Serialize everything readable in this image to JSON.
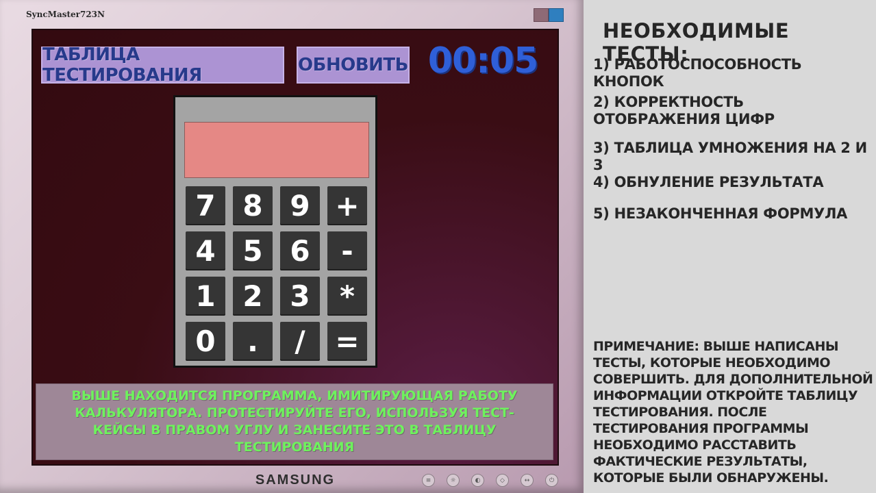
{
  "monitor": {
    "model": "SyncMaster723N",
    "brand": "SAMSUNG"
  },
  "toolbar": {
    "table_button_label": "ТАБЛИЦА ТЕСТИРОВАНИЯ",
    "refresh_button_label": "ОБНОВИТЬ",
    "timer": "00:05"
  },
  "calculator": {
    "display_value": "",
    "keys": [
      "7",
      "8",
      "9",
      "+",
      "4",
      "5",
      "6",
      "-",
      "1",
      "2",
      "3",
      "*",
      "0",
      ".",
      "/",
      "="
    ]
  },
  "instructions": "ВЫШЕ НАХОДИТСЯ ПРОГРАММА, ИМИТИРУЮЩАЯ РАБОТУ КАЛЬКУЛЯТОРА. ПРОТЕСТИРУЙТЕ ЕГО, ИСПОЛЬЗУЯ ТЕСТ-КЕЙСЫ В ПРАВОМ УГЛУ И ЗАНЕСИТЕ ЭТО В ТАБЛИЦУ ТЕСТИРОВАНИЯ",
  "side_panel": {
    "title": "НЕОБХОДИМЫЕ ТЕСТЫ:",
    "tests": [
      "1) РАБОТОСПОСОБНОСТЬ КНОПОК",
      "2) КОРРЕКТНОСТЬ ОТОБРАЖЕНИЯ ЦИФР",
      "3) ТАБЛИЦА УМНОЖЕНИЯ НА 2 И 3",
      "4) ОБНУЛЕНИЕ РЕЗУЛЬТАТА",
      "5) НЕЗАКОНЧЕННАЯ ФОРМУЛА"
    ],
    "note": "ПРИМЕЧАНИЕ: ВЫШЕ НАПИСАНЫ ТЕСТЫ, КОТОРЫЕ НЕОБХОДИМО СОВЕРШИТЬ. ДЛЯ ДОПОЛНИТЕЛЬНОЙ ИНФОРМАЦИИ ОТКРОЙТЕ ТАБЛИЦУ ТЕСТИРОВАНИЯ. ПОСЛЕ ТЕСТИРОВАНИЯ ПРОГРАММЫ НЕОБХОДИМО РАССТАВИТЬ ФАКТИЧЕСКИЕ РЕЗУЛЬТАТЫ, КОТОРЫЕ БЫЛИ ОБНАРУЖЕНЫ."
  },
  "monitor_controls": [
    "menu-icon",
    "brightness-icon",
    "contrast-icon",
    "auto-icon",
    "source-icon",
    "power-icon"
  ],
  "colors": {
    "button_bg": "#ac93d3",
    "button_text": "#273a8b",
    "timer": "#2f5fd8",
    "instructions_text": "#6ef25d",
    "display_bg": "#e58885",
    "key_bg": "#353535"
  }
}
